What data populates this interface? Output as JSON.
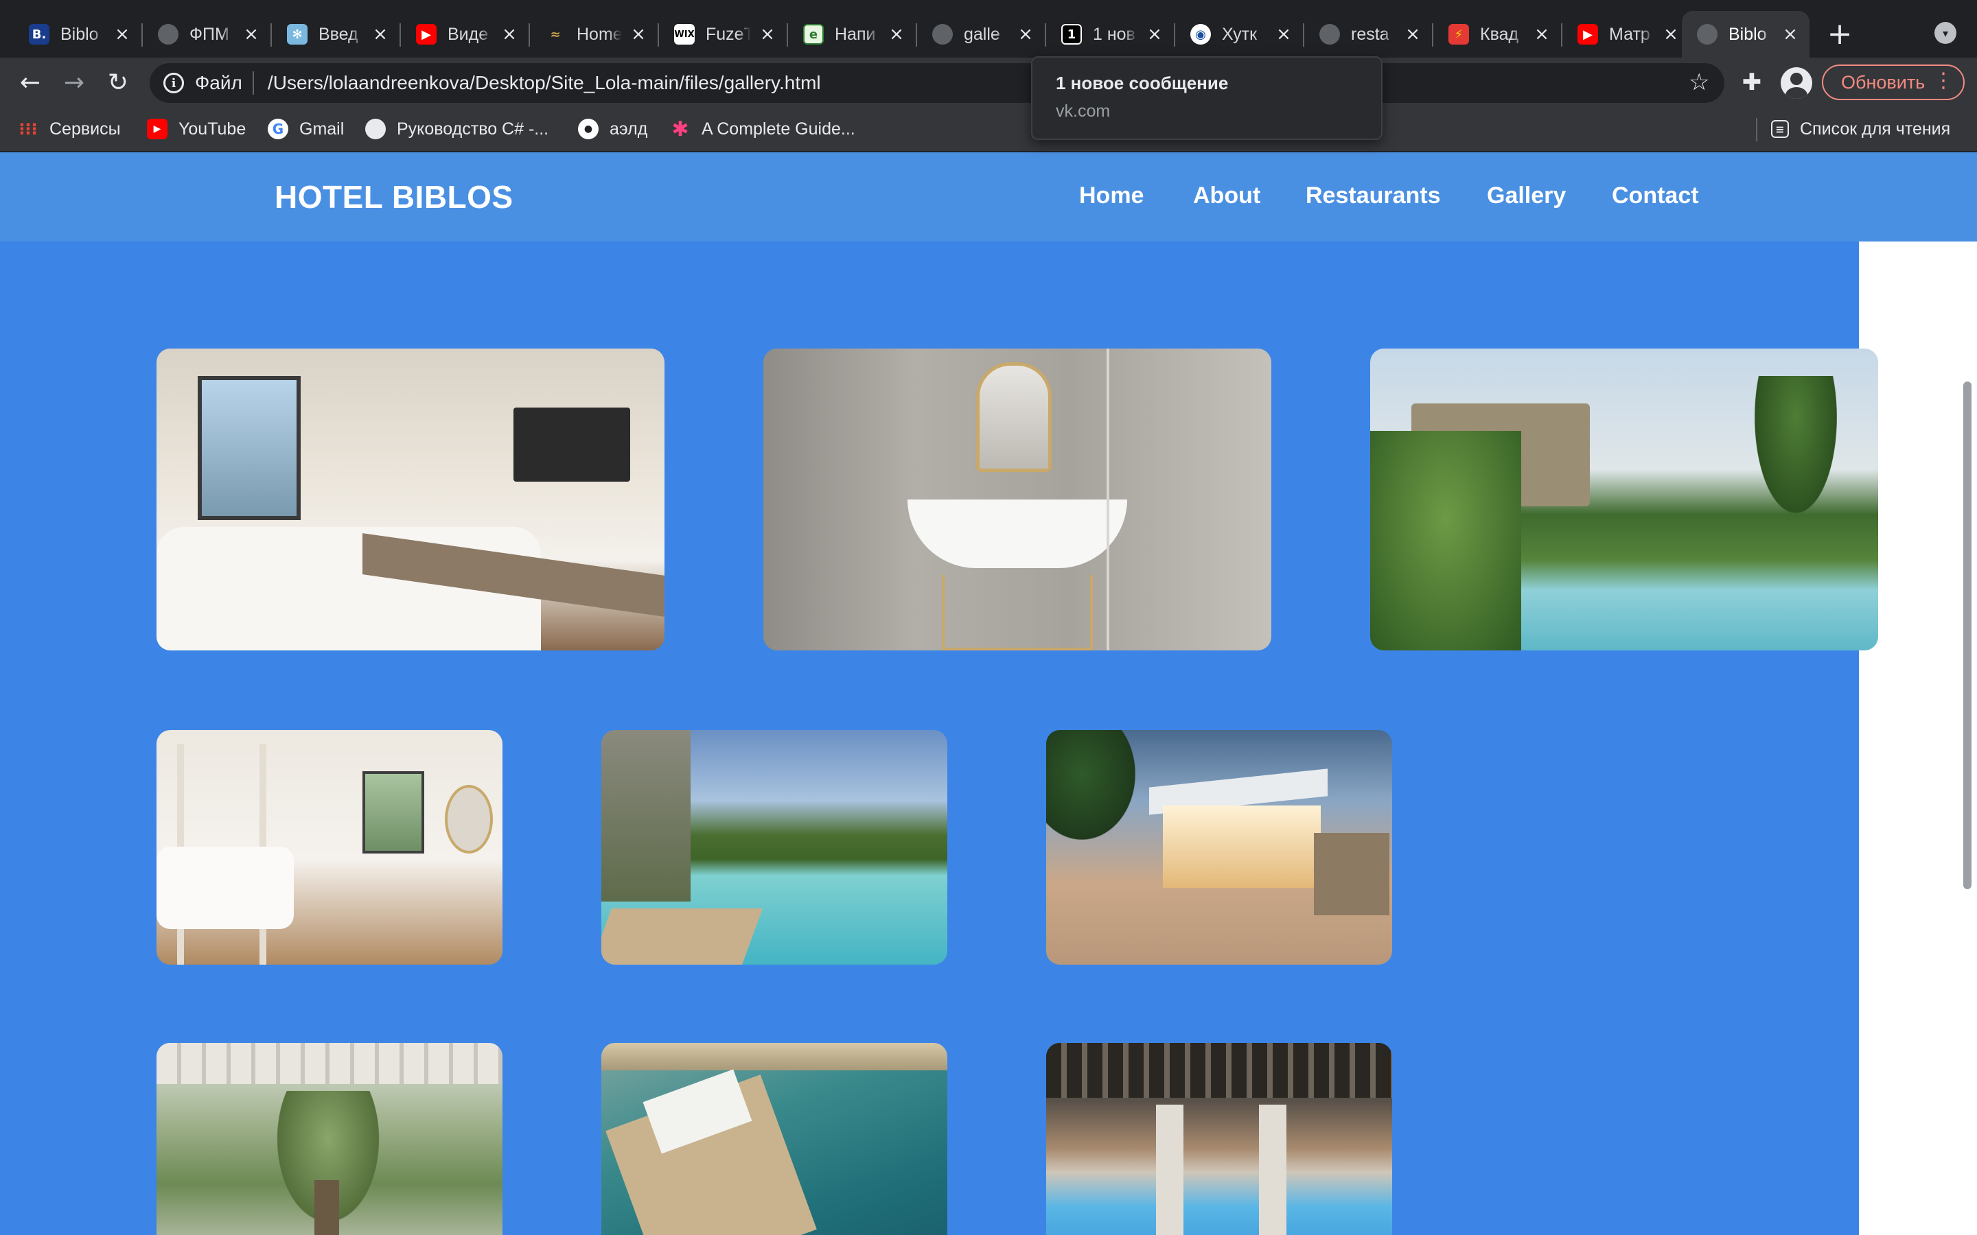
{
  "browser": {
    "tabs": [
      {
        "label": "Biblo",
        "icon": "booking-b-icon"
      },
      {
        "label": "ФПМ",
        "icon": "globe-icon"
      },
      {
        "label": "Введ",
        "icon": "snowflake-icon"
      },
      {
        "label": "Виде",
        "icon": "youtube-icon"
      },
      {
        "label": "Home",
        "icon": "bird-icon"
      },
      {
        "label": "FuzeT",
        "icon": "wix-icon"
      },
      {
        "label": "Напи",
        "icon": "doc-icon"
      },
      {
        "label": "galle",
        "icon": "globe-icon"
      },
      {
        "label": "1 нов",
        "icon": "vk-icon"
      },
      {
        "label": "Хутк",
        "icon": "target-icon"
      },
      {
        "label": "resta",
        "icon": "globe-icon"
      },
      {
        "label": "Квад",
        "icon": "flash-icon"
      },
      {
        "label": "Матр",
        "icon": "youtube-icon"
      },
      {
        "label": "Biblo",
        "icon": "globe-icon",
        "active": true
      }
    ],
    "address": {
      "scheme": "Файл",
      "url": "/Users/lolaandreenkova/Desktop/Site_Lola-main/files/gallery.html"
    },
    "update_label": "Обновить",
    "bookmarks": [
      {
        "label": "Сервисы",
        "icon": "apps-grid-icon"
      },
      {
        "label": "YouTube",
        "icon": "youtube-icon"
      },
      {
        "label": "Gmail",
        "icon": "google-icon"
      },
      {
        "label": "Руководство C# -...",
        "icon": "globe-icon"
      },
      {
        "label": "аэлд",
        "icon": "chat-icon"
      },
      {
        "label": "A Complete Guide...",
        "icon": "asterisk-icon"
      }
    ],
    "reading_list": "Список для чтения",
    "notification": {
      "title": "1 новое сообщение",
      "source": "vk.com"
    }
  },
  "site": {
    "logo": "HOTEL BIBLOS",
    "nav": [
      "Home",
      "About",
      "Restaurants",
      "Gallery",
      "Contact"
    ],
    "accent_color": "#3c85e6",
    "header_color": "#4a90e2"
  },
  "gallery": [
    {
      "subject": "hotel-bedroom"
    },
    {
      "subject": "bathroom"
    },
    {
      "subject": "pool-cabanas"
    },
    {
      "subject": "canopy-bedroom"
    },
    {
      "subject": "outdoor-pool"
    },
    {
      "subject": "patisserie-kiosk"
    },
    {
      "subject": "olive-tree-restaurant"
    },
    {
      "subject": "sea-platform"
    },
    {
      "subject": "indoor-pool"
    }
  ]
}
